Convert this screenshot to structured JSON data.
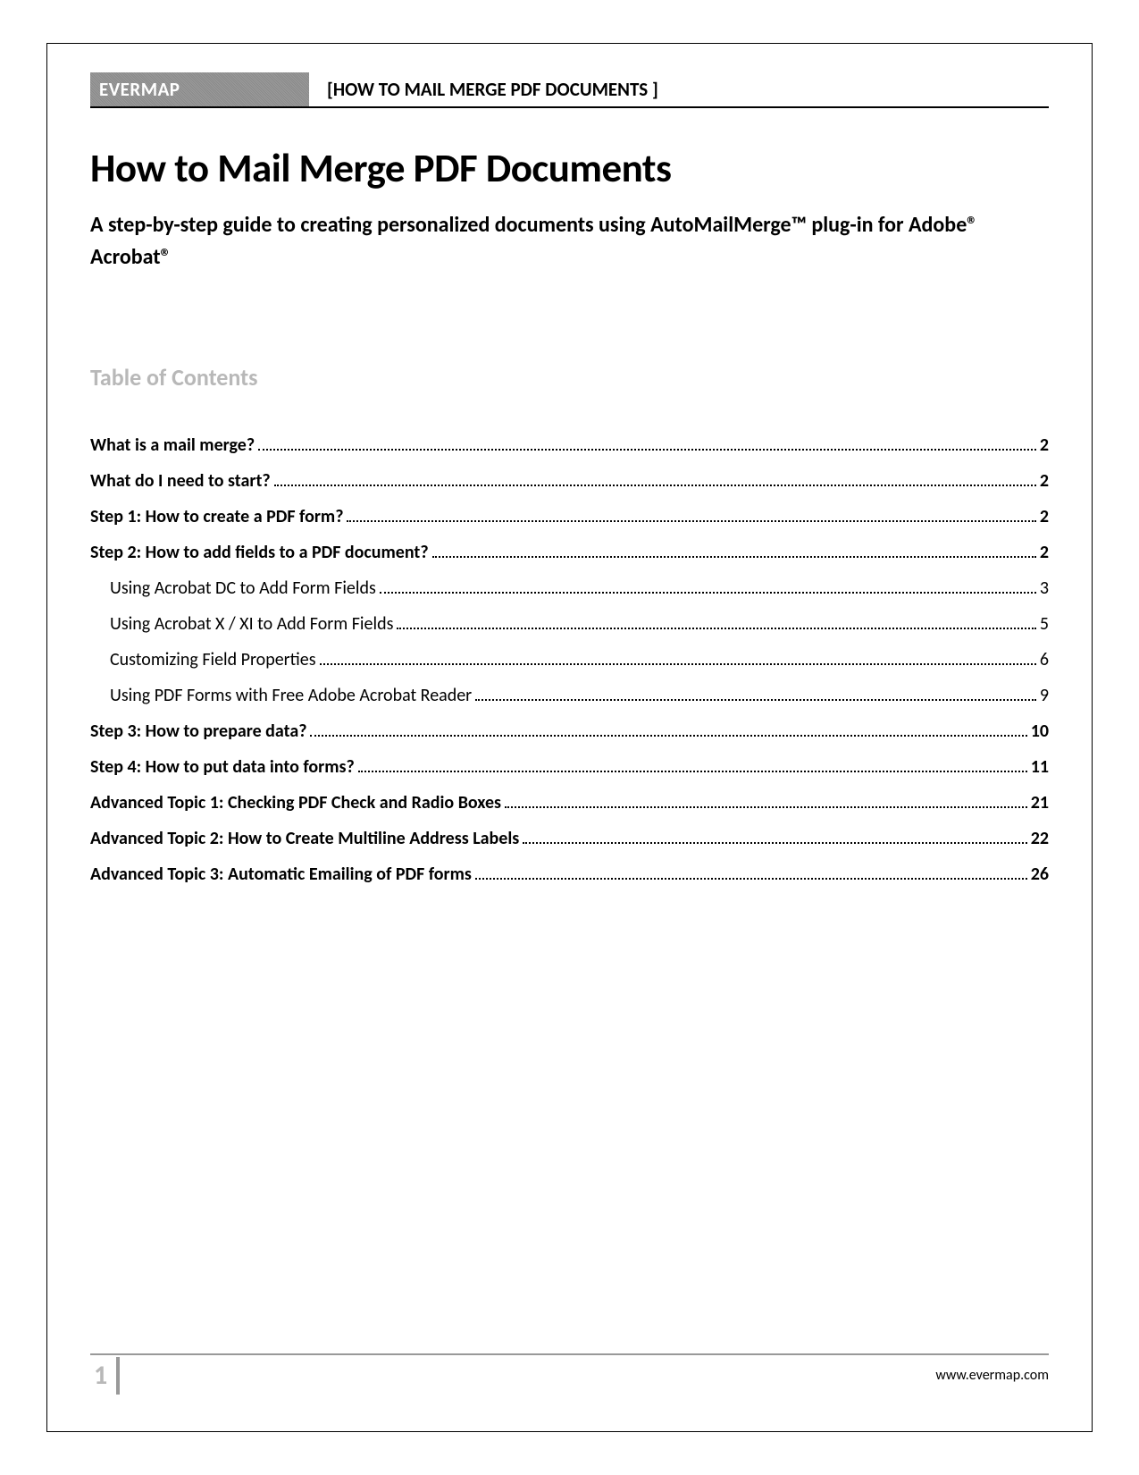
{
  "header": {
    "brand": "EVERMAP",
    "title": "[HOW TO MAIL MERGE PDF DOCUMENTS ]"
  },
  "document": {
    "title": "How to Mail Merge PDF Documents",
    "subtitle": "A step-by-step guide to creating personalized documents using AutoMailMerge™ plug-in for Adobe® Acrobat®"
  },
  "toc": {
    "heading": "Table of Contents",
    "items": [
      {
        "label": "What is a mail merge?",
        "page": "2",
        "level": 1
      },
      {
        "label": "What do I need to start?",
        "page": "2",
        "level": 1
      },
      {
        "label": "Step 1: How to create a PDF form?",
        "page": "2",
        "level": 1
      },
      {
        "label": "Step 2: How to add fields to a PDF document?",
        "page": "2",
        "level": 1
      },
      {
        "label": "Using Acrobat DC to Add Form Fields",
        "page": "3",
        "level": 2
      },
      {
        "label": "Using Acrobat X / XI to Add Form Fields",
        "page": "5",
        "level": 2
      },
      {
        "label": "Customizing Field Properties",
        "page": "6",
        "level": 2
      },
      {
        "label": "Using PDF Forms with Free Adobe Acrobat Reader",
        "page": "9",
        "level": 2
      },
      {
        "label": "Step 3: How to prepare data?",
        "page": "10",
        "level": 1
      },
      {
        "label": "Step 4: How to put data into forms?",
        "page": "11",
        "level": 1
      },
      {
        "label": "Advanced Topic 1: Checking PDF Check and Radio Boxes",
        "page": "21",
        "level": 1
      },
      {
        "label": "Advanced Topic 2: How to Create Multiline Address Labels",
        "page": "22",
        "level": 1
      },
      {
        "label": "Advanced Topic 3: Automatic Emailing of PDF forms",
        "page": "26",
        "level": 1
      }
    ]
  },
  "footer": {
    "page_number": "1",
    "url": "www.evermap.com"
  }
}
